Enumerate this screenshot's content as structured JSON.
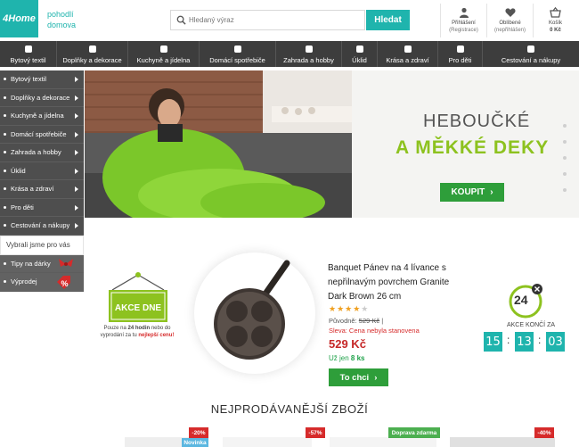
{
  "header": {
    "logo": "4Home",
    "slogan_line1": "pohodlí",
    "slogan_line2": "domova",
    "search_placeholder": "Hledaný výraz",
    "search_button": "Hledat",
    "login_label": "Přihlášení",
    "login_sub": "(Registrace)",
    "fav_label": "Oblíbené",
    "fav_sub": "(nepřihlášen)",
    "cart_label": "Košík",
    "cart_value": "0 Kč"
  },
  "topnav": [
    {
      "label": "Bytový textil"
    },
    {
      "label": "Doplňky a dekorace"
    },
    {
      "label": "Kuchyně a jídelna"
    },
    {
      "label": "Domácí spotřebiče"
    },
    {
      "label": "Zahrada a hobby"
    },
    {
      "label": "Úklid"
    },
    {
      "label": "Krása a zdraví"
    },
    {
      "label": "Pro děti"
    },
    {
      "label": "Cestování a nákupy"
    }
  ],
  "sidebar": {
    "items": [
      {
        "label": "Bytový textil"
      },
      {
        "label": "Doplňky a dekorace"
      },
      {
        "label": "Kuchyně a jídelna"
      },
      {
        "label": "Domácí spotřebiče"
      },
      {
        "label": "Zahrada a hobby"
      },
      {
        "label": "Úklid"
      },
      {
        "label": "Krása a zdraví"
      },
      {
        "label": "Pro děti"
      },
      {
        "label": "Cestování a nákupy"
      }
    ],
    "picked_title": "Vybrali jsme pro vás",
    "picked": [
      {
        "label": "Tipy na dárky"
      },
      {
        "label": "Výprodej"
      }
    ]
  },
  "hero": {
    "title_line1": "HEBOUČKÉ",
    "title_line2": "A MĚKKÉ DEKY",
    "button": "KOUPIT"
  },
  "deal": {
    "sign_label": "AKCE DNE",
    "note_1": "Pouze na",
    "note_bold": "24 hodin",
    "note_2": "nebo do vyprodání za tu",
    "note_red": "nejlepší cenu",
    "note_end": "!",
    "product_title": "Banquet Pánev na 4 lívance s nepřilnavým povrchem Granite Dark Brown 26 cm",
    "rating": 4,
    "rating_max": 5,
    "orig_label": "Původně:",
    "orig_price": "529 Kč",
    "discount_text": "Sleva: Cena nebyla stanovena",
    "price": "529 Kč",
    "stock_label": "Už jen",
    "stock_value": "8 ks",
    "buy_button": "To chci",
    "clock_label": "24",
    "countdown_title": "AKCE KONČÍ ZA",
    "countdown": [
      "15",
      "13",
      "03"
    ]
  },
  "bestsellers": {
    "title": "NEJPRODÁVANĚJŠÍ ZBOŽÍ",
    "tags": [
      "-20%",
      "Novinka",
      "-57%",
      "Doprava zdarma",
      "-40%"
    ]
  },
  "colors": {
    "accent": "#1fb4ad",
    "green": "#8dc21f",
    "button_green": "#2e9e3a",
    "nav_dark": "#3d3d3d",
    "price_red": "#c62828"
  }
}
